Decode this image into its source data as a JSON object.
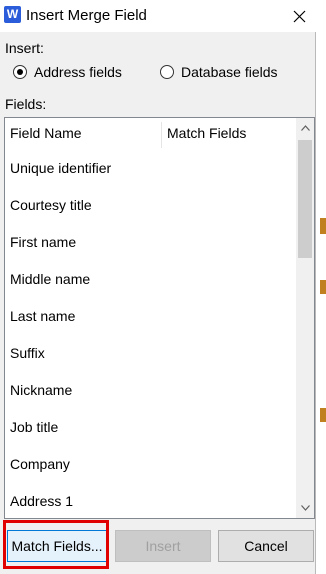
{
  "titlebar": {
    "app_icon_letter": "W",
    "title": "Insert Merge Field",
    "close_icon": "close-icon"
  },
  "insert_group": {
    "label": "Insert:",
    "options": [
      {
        "label": "Address fields",
        "checked": true
      },
      {
        "label": "Database fields",
        "checked": false
      }
    ]
  },
  "fields": {
    "label": "Fields:",
    "columns": [
      "Field Name",
      "Match Fields"
    ],
    "rows": [
      "Unique identifier",
      "Courtesy title",
      "First name",
      "Middle name",
      "Last name",
      "Suffix",
      "Nickname",
      "Job title",
      "Company",
      "Address 1"
    ]
  },
  "buttons": {
    "match_fields": "Match Fields...",
    "insert": "Insert",
    "cancel": "Cancel"
  },
  "colors": {
    "highlight": "#e00000",
    "app_icon": "#2b5cd9"
  }
}
